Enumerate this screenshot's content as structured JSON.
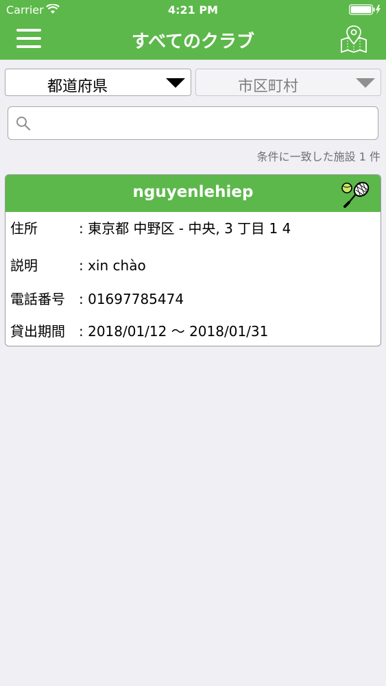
{
  "status": {
    "carrier": "Carrier",
    "time": "4:21 PM"
  },
  "nav": {
    "title": "すべてのクラブ",
    "menu_icon": "hamburger-menu-icon",
    "map_icon": "map-pin-icon"
  },
  "filters": {
    "prefecture_label": "都道府県",
    "city_label": "市区町村"
  },
  "search": {
    "placeholder": "",
    "value": ""
  },
  "result_count": "条件に一致した施設 1 件",
  "card": {
    "title": "nguyenlehiep",
    "icon": "tennis-racket-icon",
    "rows": [
      {
        "key": "住所",
        "value": ": 東京都 中野区 - 中央, 3 丁目 1  4"
      },
      {
        "key": "説明",
        "value": ": xin chào"
      },
      {
        "key": "電話番号",
        "value": ": 01697785474"
      },
      {
        "key": "貸出期間",
        "value": ": 2018/01/12  ～  2018/01/31"
      }
    ]
  },
  "colors": {
    "brand_green": "#5cb84a",
    "background": "#efeff4"
  }
}
